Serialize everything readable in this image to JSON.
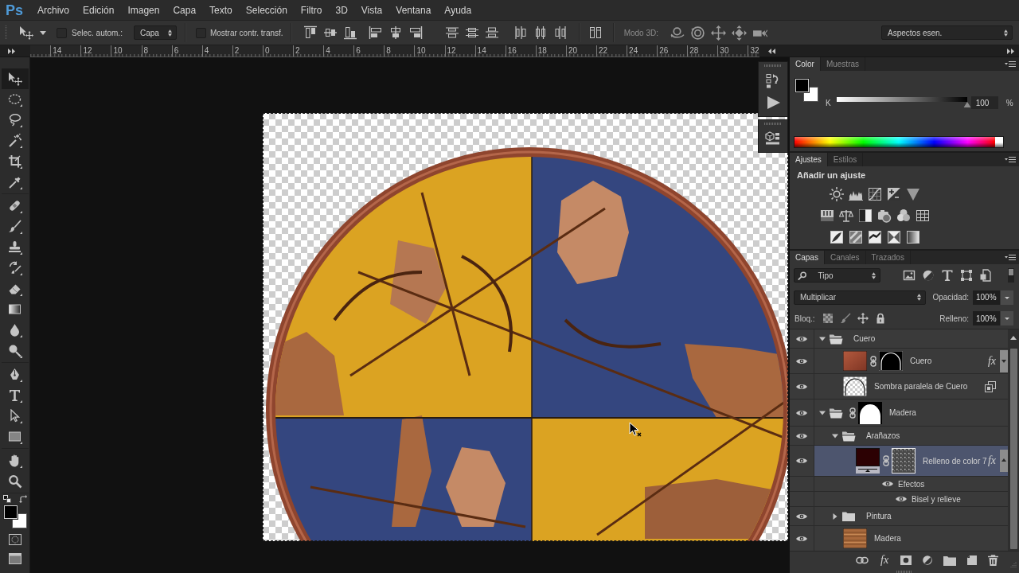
{
  "app": {
    "logo": "Ps"
  },
  "menu": [
    "Archivo",
    "Edición",
    "Imagen",
    "Capa",
    "Texto",
    "Selección",
    "Filtro",
    "3D",
    "Vista",
    "Ventana",
    "Ayuda"
  ],
  "options_bar": {
    "auto_select": {
      "label": "Selec. autom.:",
      "checked": false
    },
    "auto_select_target": {
      "value": "Capa"
    },
    "transform_controls": {
      "label": "Mostrar contr. transf.",
      "checked": false
    },
    "mode_3d": {
      "label": "Modo 3D:"
    },
    "workspace": {
      "value": "Aspectos esen."
    }
  },
  "ruler": {
    "labels": [
      "14",
      "12",
      "10",
      "8",
      "6",
      "4",
      "2",
      "0",
      "2",
      "4",
      "6",
      "8",
      "10",
      "12",
      "14",
      "16",
      "18",
      "20",
      "22",
      "24",
      "26",
      "28",
      "30",
      "32"
    ]
  },
  "toolbar": {
    "tool_groups": [
      [
        {
          "kind": "move",
          "selected": true
        },
        {
          "kind": "elliptical-marquee",
          "selected": false
        },
        {
          "kind": "lasso",
          "selected": false
        },
        {
          "kind": "magic-wand",
          "selected": false
        },
        {
          "kind": "crop",
          "selected": false
        },
        {
          "kind": "eyedropper",
          "selected": false
        }
      ],
      [
        {
          "kind": "healing-brush",
          "selected": false
        },
        {
          "kind": "brush",
          "selected": false
        },
        {
          "kind": "clone-stamp",
          "selected": false
        },
        {
          "kind": "history-brush",
          "selected": false
        },
        {
          "kind": "eraser",
          "selected": false
        },
        {
          "kind": "gradient",
          "selected": false
        },
        {
          "kind": "blur",
          "selected": false
        },
        {
          "kind": "dodge",
          "selected": false
        }
      ],
      [
        {
          "kind": "pen",
          "selected": false
        },
        {
          "kind": "type",
          "selected": false
        },
        {
          "kind": "path-selection",
          "selected": false
        },
        {
          "kind": "rectangle",
          "selected": false
        }
      ],
      [
        {
          "kind": "hand",
          "selected": false
        },
        {
          "kind": "zoom",
          "selected": false
        }
      ]
    ],
    "swatches": [
      {
        "kind": "foreground",
        "color": "#000000"
      },
      {
        "kind": "background",
        "color": "#ffffff"
      }
    ]
  },
  "color_panel": {
    "tabs": [
      {
        "label": "Color",
        "selected": true
      },
      {
        "label": "Muestras",
        "selected": false
      }
    ],
    "swatches": [
      {
        "kind": "foreground",
        "color": "#000000"
      },
      {
        "kind": "background",
        "color": "#ffffff"
      }
    ],
    "slider": {
      "label": "K",
      "level": 1,
      "value": "100",
      "unit": "%"
    }
  },
  "adjustments_panel": {
    "tabs": [
      {
        "label": "Ajustes",
        "selected": true
      },
      {
        "label": "Estilos",
        "selected": false
      }
    ],
    "heading": "Añadir un ajuste"
  },
  "layers_panel": {
    "tabs": [
      {
        "label": "Capas",
        "selected": true
      },
      {
        "label": "Canales",
        "selected": false
      },
      {
        "label": "Trazados",
        "selected": false
      }
    ],
    "filter": {
      "value": "Tipo"
    },
    "blend_mode": {
      "value": "Multiplicar"
    },
    "opacity": {
      "label": "Opacidad:",
      "value": "100%"
    },
    "lock": {
      "label": "Bloq.:"
    },
    "fill": {
      "label": "Relleno:",
      "value": "100%"
    },
    "layers": [
      {
        "kind": "group",
        "name": "Cuero",
        "visible": true,
        "selected": false,
        "expanded": true,
        "children": [
          {
            "kind": "layer",
            "name": "Cuero",
            "visible": true,
            "selected": false,
            "thumbnail": {
              "kind": "leather"
            },
            "mask": {
              "kind": "arc"
            },
            "smart_object": false,
            "style_badge": "fx",
            "effects_expanded": false
          },
          {
            "kind": "layer",
            "name": "Sombra paralela de Cuero",
            "visible": true,
            "selected": false,
            "thumbnail": {
              "kind": "shadow"
            },
            "smart_object": true
          }
        ]
      },
      {
        "kind": "group",
        "name": "Madera",
        "visible": true,
        "selected": false,
        "expanded": true,
        "mask": {
          "kind": "dome"
        },
        "children": [
          {
            "kind": "group",
            "name": "Arañazos",
            "visible": true,
            "selected": false,
            "expanded": true,
            "children": [
              {
                "kind": "layer",
                "name": "Relleno de color 7",
                "visible": true,
                "selected": true,
                "thumbnail": {
                  "kind": "color-fill"
                },
                "mask": {
                  "kind": "noise"
                },
                "smart_object": false,
                "style_badge": "fx",
                "effects_expanded": true,
                "effects": {
                  "label": "Efectos",
                  "visible": true,
                  "items": [
                    {
                      "name": "Bisel y relieve",
                      "visible": true
                    }
                  ]
                }
              }
            ]
          },
          {
            "kind": "group",
            "name": "Pintura",
            "visible": true,
            "selected": false,
            "expanded": false
          },
          {
            "kind": "layer",
            "name": "Madera",
            "visible": true,
            "selected": false,
            "thumbnail": {
              "kind": "wood"
            },
            "smart_object": false
          }
        ]
      }
    ],
    "footer": {
      "style_button": "fx"
    }
  }
}
